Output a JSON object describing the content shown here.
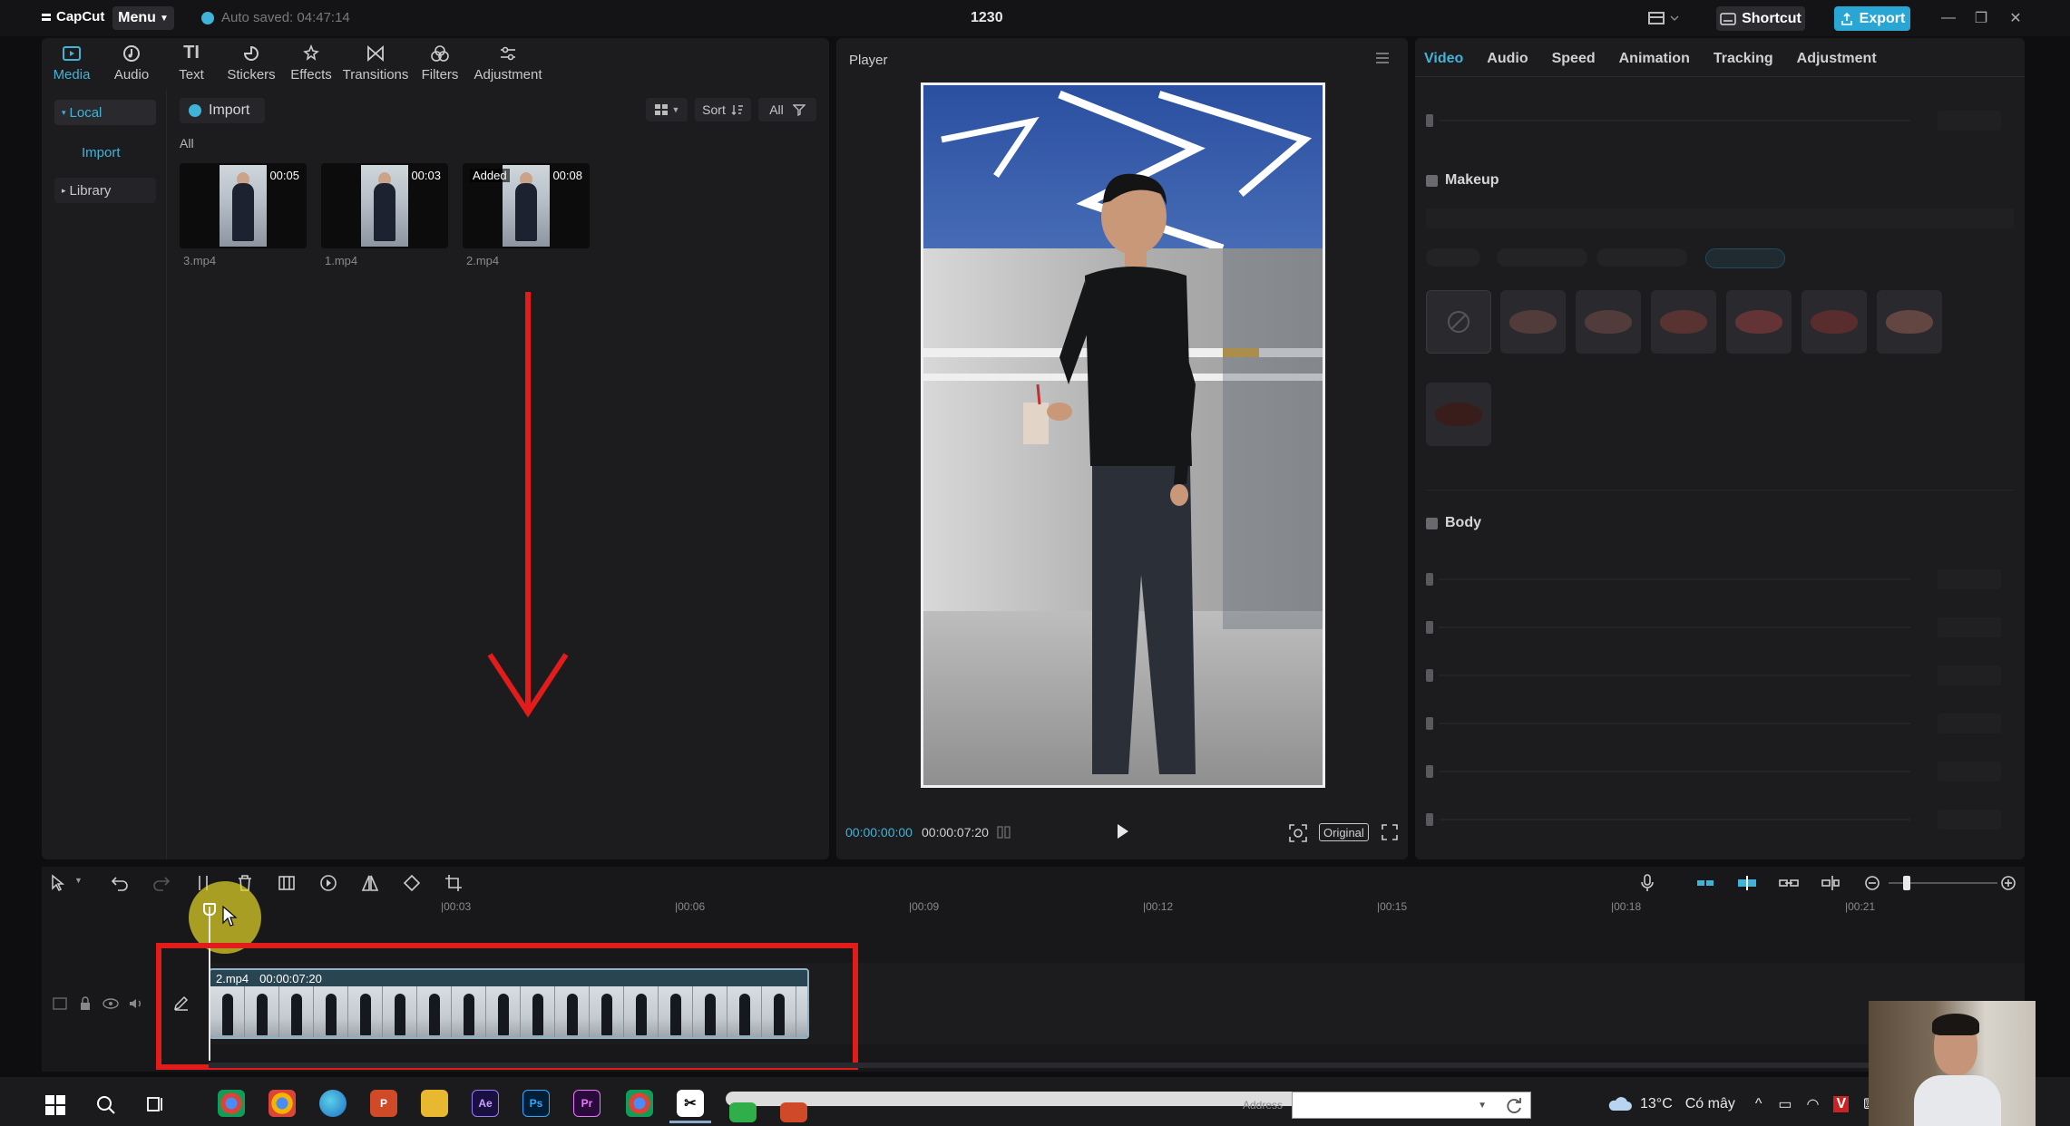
{
  "titlebar": {
    "app_name": "CapCut",
    "menu_label": "Menu",
    "autosave_text": "Auto saved: 04:47:14",
    "project_title": "1230",
    "shortcut_label": "Shortcut",
    "export_label": "Export"
  },
  "media_tabs": [
    {
      "label": "Media",
      "icon": "media-icon",
      "active": true
    },
    {
      "label": "Audio",
      "icon": "audio-icon"
    },
    {
      "label": "Text",
      "icon": "text-icon"
    },
    {
      "label": "Stickers",
      "icon": "stickers-icon"
    },
    {
      "label": "Effects",
      "icon": "effects-icon"
    },
    {
      "label": "Transitions",
      "icon": "transitions-icon"
    },
    {
      "label": "Filters",
      "icon": "filters-icon"
    },
    {
      "label": "Adjustment",
      "icon": "adjustment-icon"
    }
  ],
  "sidenav": {
    "local": "Local",
    "import": "Import",
    "library": "Library"
  },
  "media": {
    "import_label": "Import",
    "sort_label": "Sort",
    "filter_label": "All",
    "all_label": "All",
    "items": [
      {
        "name": "3.mp4",
        "duration": "00:05",
        "added": ""
      },
      {
        "name": "1.mp4",
        "duration": "00:03",
        "added": ""
      },
      {
        "name": "2.mp4",
        "duration": "00:08",
        "added": "Added"
      }
    ]
  },
  "player": {
    "title": "Player",
    "current_time": "00:00:00:00",
    "total_time": "00:00:07:20",
    "ratio_label": "Original"
  },
  "inspector": {
    "tabs": [
      {
        "label": "Video",
        "active": true
      },
      {
        "label": "Audio"
      },
      {
        "label": "Speed"
      },
      {
        "label": "Animation"
      },
      {
        "label": "Tracking"
      },
      {
        "label": "Adjustment"
      }
    ],
    "makeup_label": "Makeup",
    "body_label": "Body"
  },
  "timeline": {
    "ticks": [
      "|00:03",
      "|00:06",
      "|00:09",
      "|00:12",
      "|00:15",
      "|00:18",
      "|00:21"
    ],
    "clip": {
      "name": "2.mp4",
      "duration": "00:00:07:20"
    }
  },
  "taskbar": {
    "address_label": "Address",
    "weather": "13°C",
    "weather_text": "Có mây"
  },
  "colors": {
    "accent": "#3fb4d8",
    "annotation": "#e21b1b",
    "export": "#2aa6d4"
  }
}
